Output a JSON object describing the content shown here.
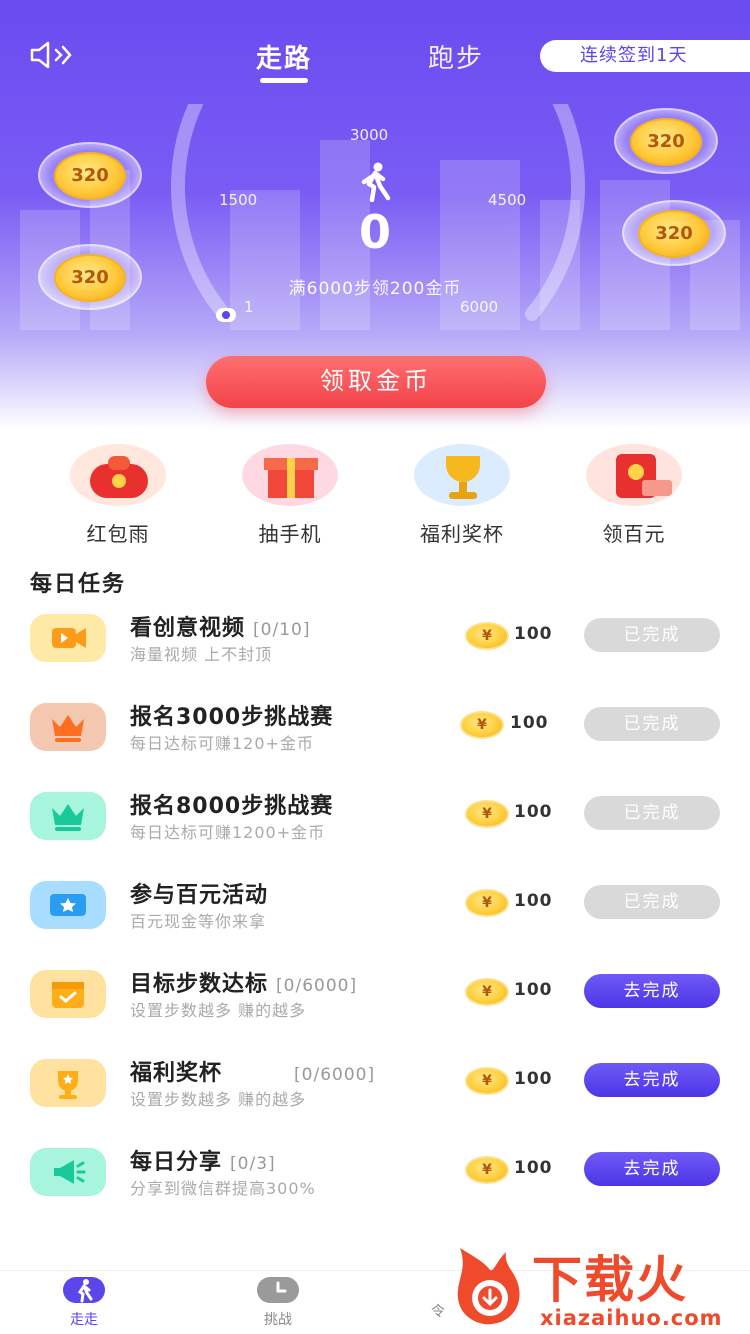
{
  "header": {
    "sound_icon": "speaker-icon",
    "tabs": [
      {
        "label": "走路",
        "active": true
      },
      {
        "label": "跑步",
        "active": false
      }
    ],
    "signin_label": "连续签到1天"
  },
  "gauge": {
    "ticks": [
      "1",
      "1500",
      "3000",
      "4500",
      "6000"
    ],
    "steps": "0",
    "progress": 0,
    "hint": "满6000步领200金币"
  },
  "bubbles": [
    "320",
    "320",
    "320",
    "320"
  ],
  "claim_button": "领取金币",
  "entries": [
    {
      "label": "红包雨",
      "icon": "red-envelope-icon"
    },
    {
      "label": "抽手机",
      "icon": "gift-box-icon"
    },
    {
      "label": "福利奖杯",
      "icon": "trophy-icon"
    },
    {
      "label": "领百元",
      "icon": "red-packet-cash-icon"
    }
  ],
  "section_title": "每日任务",
  "coin_symbol": "¥",
  "tasks": [
    {
      "name": "看创意视频",
      "progress": "[0/10]",
      "desc": "海量视频 上不封顶",
      "reward": "100",
      "button": "已完成",
      "done": true,
      "icon": "video-icon"
    },
    {
      "name": "报名3000步挑战赛",
      "progress": "",
      "desc": "每日达标可赚120+金币",
      "reward": "100",
      "button": "已完成",
      "done": true,
      "icon": "crown-icon"
    },
    {
      "name": "报名8000步挑战赛",
      "progress": "",
      "desc": "每日达标可赚1200+金币",
      "reward": "100",
      "button": "已完成",
      "done": true,
      "icon": "crown-icon"
    },
    {
      "name": "参与百元活动",
      "progress": "",
      "desc": "百元现金等你来拿",
      "reward": "100",
      "button": "已完成",
      "done": true,
      "icon": "ticket-icon"
    },
    {
      "name": "目标步数达标",
      "progress": "[0/6000]",
      "desc": "设置步数越多 赚的越多",
      "reward": "100",
      "button": "去完成",
      "done": false,
      "icon": "calendar-icon"
    },
    {
      "name": "福利奖杯",
      "progress": "[0/6000]",
      "desc": "设置步数越多 赚的越多",
      "reward": "100",
      "button": "去完成",
      "done": false,
      "icon": "trophy-icon"
    },
    {
      "name": "每日分享",
      "progress": "[0/3]",
      "desc": "分享到微信群提高300%",
      "reward": "100",
      "button": "去完成",
      "done": false,
      "icon": "megaphone-icon"
    }
  ],
  "nav": [
    {
      "label": "走走",
      "active": true
    },
    {
      "label": "挑战",
      "active": false
    },
    {
      "label": "令",
      "active": false
    }
  ],
  "watermark": {
    "brand": "下载火",
    "url": "xiazaihuo.com"
  },
  "colors": {
    "primary": "#5b46ec",
    "claim": "#f2434a",
    "done": "#d9d9d9",
    "coin": "#ffc93a"
  }
}
